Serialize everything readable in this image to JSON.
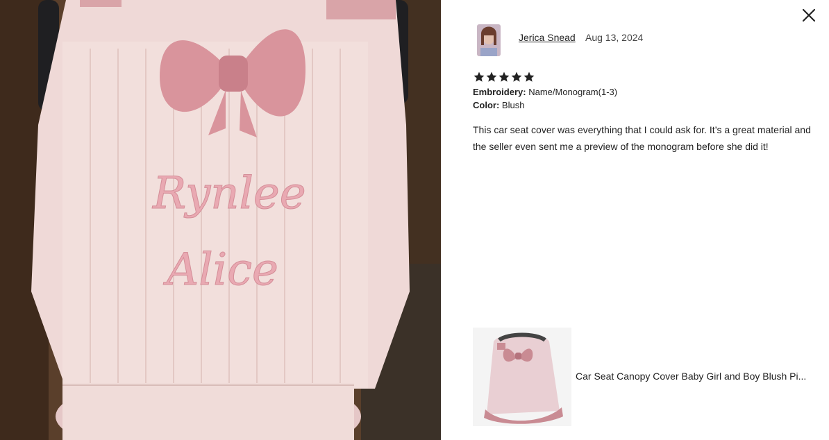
{
  "review": {
    "reviewer_name": "Jerica Snead",
    "date": "Aug 13, 2024",
    "rating": 5,
    "embroidery_label": "Embroidery:",
    "embroidery_value": "Name/Monogram(1-3)",
    "color_label": "Color:",
    "color_value": "Blush",
    "text": "This car seat cover was everything that I could ask for. It’s a great material and the seller even sent me a preview of the monogram before she did it!"
  },
  "photo": {
    "embroidered_name_line1": "Rynlee",
    "embroidered_name_line2": "Alice"
  },
  "product": {
    "title": "Car Seat Canopy Cover Baby Girl and Boy Blush Pi..."
  },
  "icons": {
    "close": "close-icon",
    "star": "star-icon"
  },
  "colors": {
    "blush": "#e8b4b8",
    "bow": "#d9949c",
    "star": "#222222"
  }
}
